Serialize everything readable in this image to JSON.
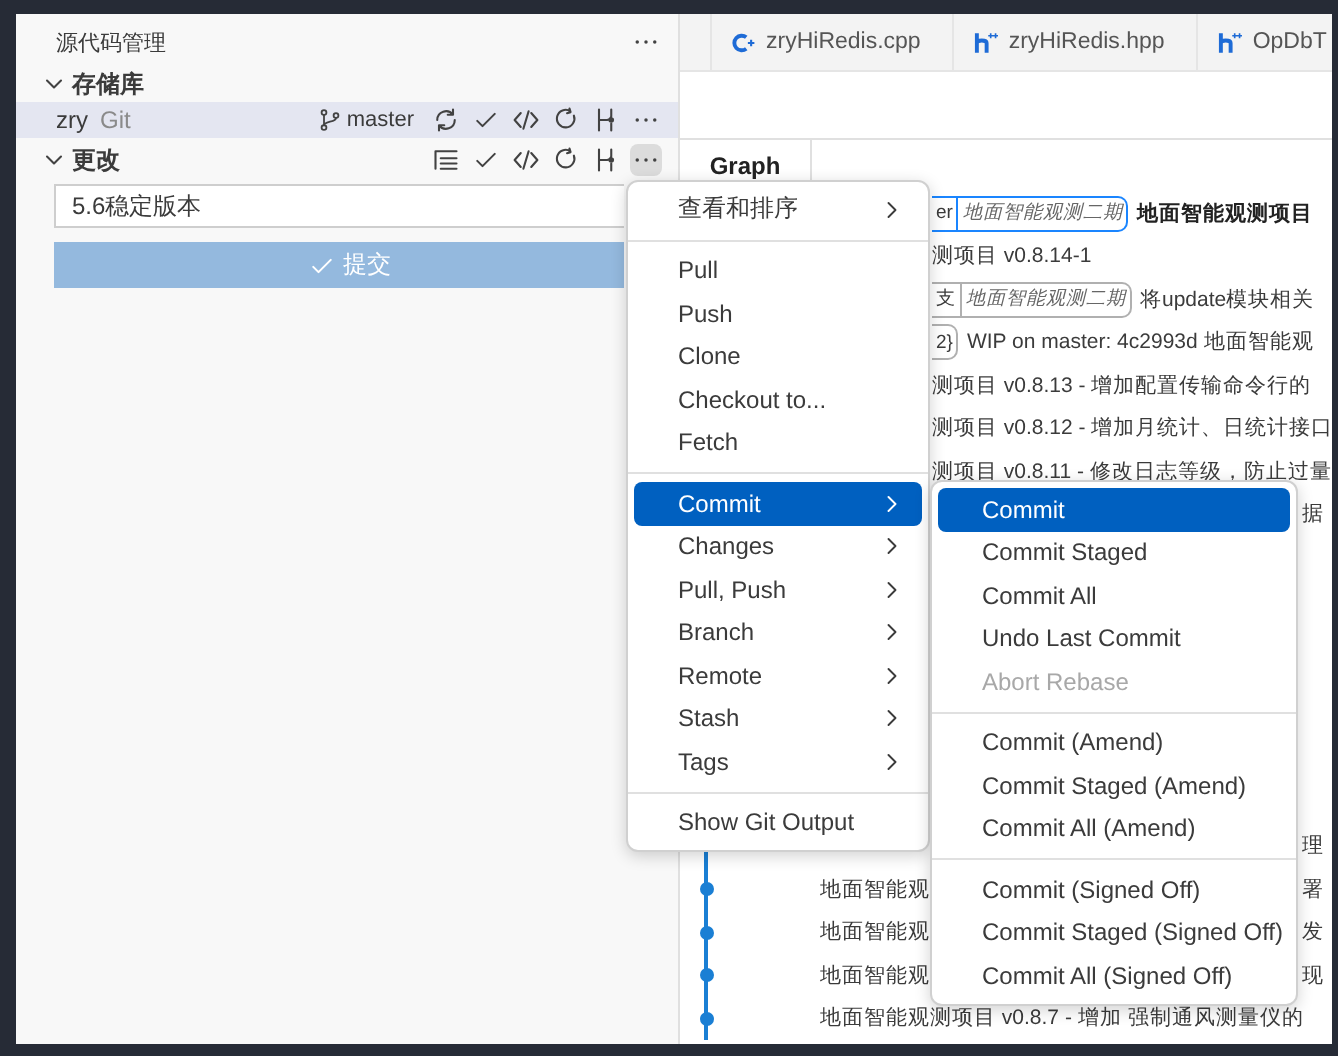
{
  "sidebar": {
    "title": "源代码管理",
    "repositories": {
      "heading": "存储库",
      "expanded": true,
      "repo": {
        "name": "zry",
        "provider": "Git",
        "branch": "master",
        "selected": true
      }
    },
    "changes": {
      "heading": "更改",
      "expanded": true,
      "more_active": true,
      "message": "5.6稳定版本",
      "commit_button": "提交"
    }
  },
  "tabs": [
    {
      "label": "zryHiRedis.cpp",
      "kind": "cpp"
    },
    {
      "label": "zryHiRedis.hpp",
      "kind": "hpp"
    },
    {
      "label": "OpDbT",
      "kind": "hpp"
    }
  ],
  "graph": {
    "header": "Graph",
    "rows": [
      {
        "tags": [
          {
            "label": "er"
          },
          {
            "label": "地面智能观测二期"
          }
        ],
        "current": true,
        "middle": "地面智能观测项目"
      },
      {
        "middle": "测项目 v0.8.14-1"
      },
      {
        "tags": [
          {
            "label": "支"
          },
          {
            "label": "地面智能观测二期"
          }
        ],
        "current": false,
        "middle": "将update模块相关"
      },
      {
        "tags": [
          {
            "label": "2}"
          }
        ],
        "current": false,
        "middle": "WIP on master: 4c2993d 地面智能观"
      },
      {
        "middle": "测项目 v0.8.13 - 增加配置传输命令行的"
      },
      {
        "middle": "测项目 v0.8.12 - 增加月统计、日统计接口"
      },
      {
        "middle": "测项目 v0.8.11 - 修改日志等级，防止过量"
      },
      {
        "right": "据"
      }
    ],
    "lower_rows": [
      {
        "right": "理"
      },
      {
        "left": "地面智能观",
        "right": "署"
      },
      {
        "left": "地面智能观",
        "right": "发"
      },
      {
        "left": "地面智能观",
        "right": "现"
      },
      {
        "left": "地面智能观测项目 v0.8.7 - 增加 强制通风测量仪的"
      }
    ]
  },
  "context_menu": {
    "items": [
      {
        "kind": "item",
        "label": "查看和排序",
        "submenu": true,
        "selected": false,
        "disabled": false
      },
      {
        "kind": "separator"
      },
      {
        "kind": "item",
        "label": "Pull",
        "submenu": false,
        "selected": false,
        "disabled": false
      },
      {
        "kind": "item",
        "label": "Push",
        "submenu": false,
        "selected": false,
        "disabled": false
      },
      {
        "kind": "item",
        "label": "Clone",
        "submenu": false,
        "selected": false,
        "disabled": false
      },
      {
        "kind": "item",
        "label": "Checkout to...",
        "submenu": false,
        "selected": false,
        "disabled": false
      },
      {
        "kind": "item",
        "label": "Fetch",
        "submenu": false,
        "selected": false,
        "disabled": false
      },
      {
        "kind": "separator"
      },
      {
        "kind": "item",
        "label": "Commit",
        "submenu": true,
        "selected": true,
        "disabled": false
      },
      {
        "kind": "item",
        "label": "Changes",
        "submenu": true,
        "selected": false,
        "disabled": false
      },
      {
        "kind": "item",
        "label": "Pull, Push",
        "submenu": true,
        "selected": false,
        "disabled": false
      },
      {
        "kind": "item",
        "label": "Branch",
        "submenu": true,
        "selected": false,
        "disabled": false
      },
      {
        "kind": "item",
        "label": "Remote",
        "submenu": true,
        "selected": false,
        "disabled": false
      },
      {
        "kind": "item",
        "label": "Stash",
        "submenu": true,
        "selected": false,
        "disabled": false
      },
      {
        "kind": "item",
        "label": "Tags",
        "submenu": true,
        "selected": false,
        "disabled": false
      },
      {
        "kind": "separator"
      },
      {
        "kind": "item",
        "label": "Show Git Output",
        "submenu": false,
        "selected": false,
        "disabled": false
      }
    ]
  },
  "submenu": {
    "items": [
      {
        "kind": "item",
        "label": "Commit",
        "selected": true,
        "disabled": false
      },
      {
        "kind": "item",
        "label": "Commit Staged",
        "selected": false,
        "disabled": false
      },
      {
        "kind": "item",
        "label": "Commit All",
        "selected": false,
        "disabled": false
      },
      {
        "kind": "item",
        "label": "Undo Last Commit",
        "selected": false,
        "disabled": false
      },
      {
        "kind": "item",
        "label": "Abort Rebase",
        "selected": false,
        "disabled": true
      },
      {
        "kind": "separator"
      },
      {
        "kind": "item",
        "label": "Commit (Amend)",
        "selected": false,
        "disabled": false
      },
      {
        "kind": "item",
        "label": "Commit Staged (Amend)",
        "selected": false,
        "disabled": false
      },
      {
        "kind": "item",
        "label": "Commit All (Amend)",
        "selected": false,
        "disabled": false
      },
      {
        "kind": "separator"
      },
      {
        "kind": "item",
        "label": "Commit (Signed Off)",
        "selected": false,
        "disabled": false
      },
      {
        "kind": "item",
        "label": "Commit Staged (Signed Off)",
        "selected": false,
        "disabled": false
      },
      {
        "kind": "item",
        "label": "Commit All (Signed Off)",
        "selected": false,
        "disabled": false
      }
    ]
  }
}
